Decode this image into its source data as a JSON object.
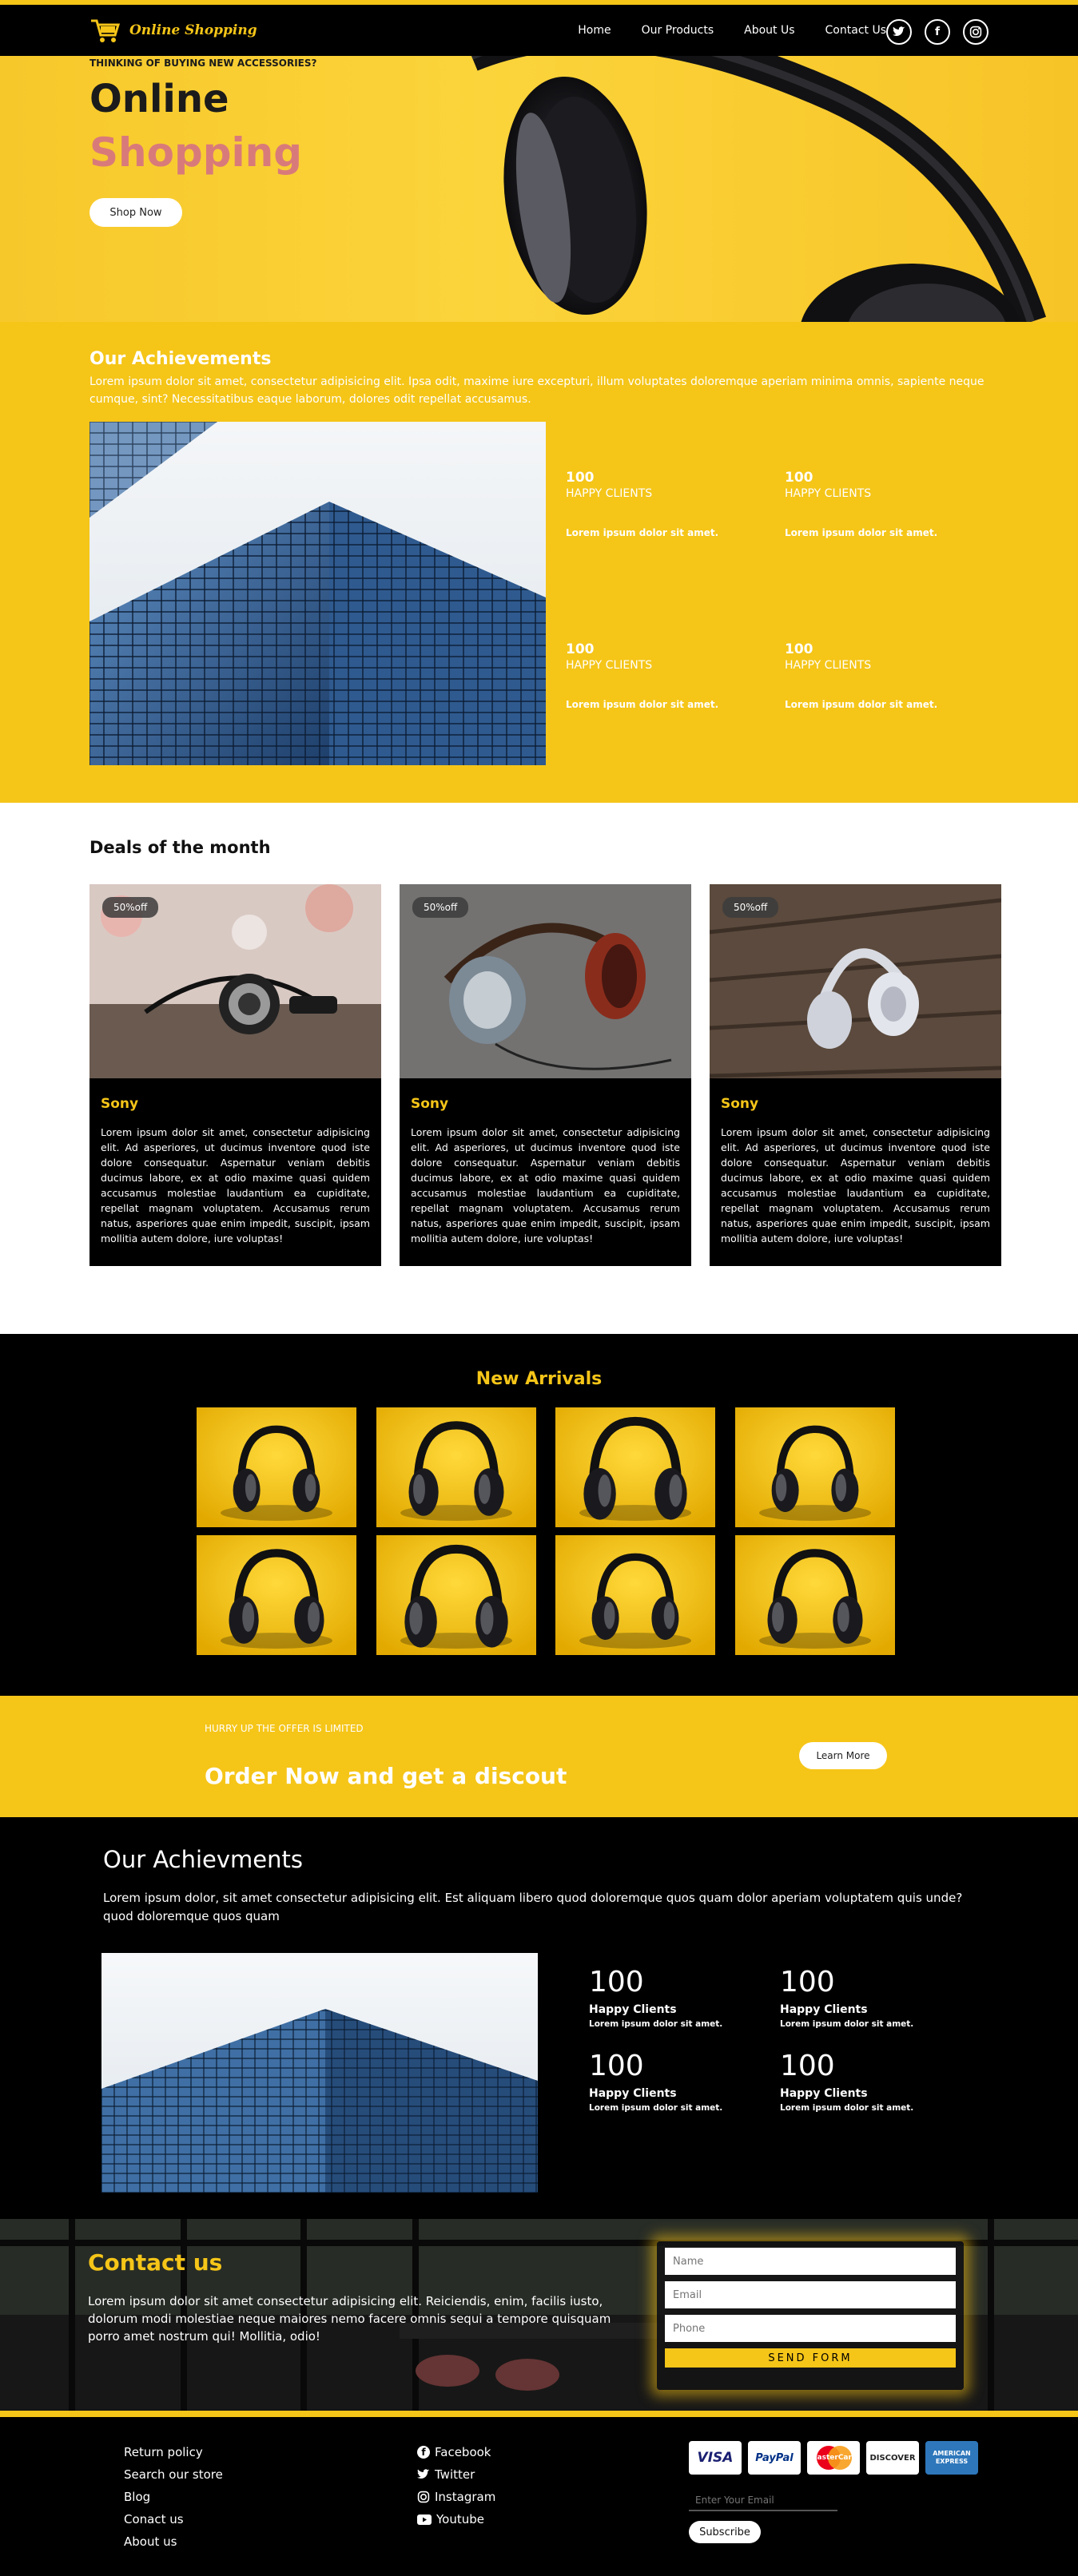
{
  "nav": {
    "brand": "Online Shopping",
    "links": [
      "Home",
      "Our Products",
      "About Us",
      "Contact Us"
    ],
    "social_icons": [
      "twitter-icon",
      "facebook-icon",
      "instagram-icon"
    ]
  },
  "hero": {
    "tagline": "THINKING OF BUYING NEW ACCESSORIES?",
    "title_line1": "Online",
    "title_line2": "Shopping",
    "button": "Shop Now"
  },
  "achievements": {
    "title": "Our Achievements",
    "description": "Lorem ipsum dolor sit amet, consectetur adipisicing elit. Ipsa odit, maxime iure excepturi, illum voluptates doloremque aperiam minima omnis, sapiente neque cumque, sint? Necessitatibus eaque laborum, dolores odit repellat accusamus.",
    "stats": [
      {
        "value": "100",
        "label": "HAPPY CLIENTS",
        "text": "Lorem ipsum dolor sit amet."
      },
      {
        "value": "100",
        "label": "HAPPY CLIENTS",
        "text": "Lorem ipsum dolor sit amet."
      },
      {
        "value": "100",
        "label": "HAPPY CLIENTS",
        "text": "Lorem ipsum dolor sit amet."
      },
      {
        "value": "100",
        "label": "HAPPY CLIENTS",
        "text": "Lorem ipsum dolor sit amet."
      }
    ]
  },
  "deals": {
    "title": "Deals of the month",
    "cards": [
      {
        "badge": "50%off",
        "title": "Sony",
        "text": "Lorem ipsum dolor sit amet, consectetur adipisicing elit. Ad asperiores, ut ducimus inventore quod iste dolore consequatur. Aspernatur veniam debitis ducimus labore, ex at odio maxime quasi quidem accusamus molestiae laudantium ea cupiditate, repellat magnam voluptatem. Accusamus rerum natus, asperiores quae enim impedit, suscipit, ipsam mollitia autem dolore, iure voluptas!"
      },
      {
        "badge": "50%off",
        "title": "Sony",
        "text": "Lorem ipsum dolor sit amet, consectetur adipisicing elit. Ad asperiores, ut ducimus inventore quod iste dolore consequatur. Aspernatur veniam debitis ducimus labore, ex at odio maxime quasi quidem accusamus molestiae laudantium ea cupiditate, repellat magnam voluptatem. Accusamus rerum natus, asperiores quae enim impedit, suscipit, ipsam mollitia autem dolore, iure voluptas!"
      },
      {
        "badge": "50%off",
        "title": "Sony",
        "text": "Lorem ipsum dolor sit amet, consectetur adipisicing elit. Ad asperiores, ut ducimus inventore quod iste dolore consequatur. Aspernatur veniam debitis ducimus labore, ex at odio maxime quasi quidem accusamus molestiae laudantium ea cupiditate, repellat magnam voluptatem. Accusamus rerum natus, asperiores quae enim impedit, suscipit, ipsam mollitia autem dolore, iure voluptas!"
      }
    ]
  },
  "arrivals": {
    "title": "New Arrivals"
  },
  "offer": {
    "subtitle": "HURRY UP THE OFFER IS LIMITED",
    "title": "Order Now and get a discout",
    "button": "Learn More"
  },
  "achievements2": {
    "title": "Our Achievments",
    "description": "Lorem ipsum dolor, sit amet consectetur adipisicing elit. Est aliquam libero quod doloremque quos quam dolor aperiam voluptatem quis unde? quod doloremque quos quam",
    "stats": [
      {
        "value": "100",
        "label": "Happy Clients",
        "text": "Lorem ipsum dolor sit amet."
      },
      {
        "value": "100",
        "label": "Happy Clients",
        "text": "Lorem ipsum dolor sit amet."
      },
      {
        "value": "100",
        "label": "Happy Clients",
        "text": "Lorem ipsum dolor sit amet."
      },
      {
        "value": "100",
        "label": "Happy Clients",
        "text": "Lorem ipsum dolor sit amet."
      }
    ]
  },
  "contact": {
    "title": "Contact us",
    "text": "Lorem ipsum dolor sit amet consectetur adipisicing elit. Reiciendis, enim, facilis iusto, dolorum modi molestiae neque maiores nemo facere omnis sequi a tempore quisquam porro amet nostrum qui! Mollitia, odio!",
    "name_placeholder": "Name",
    "email_placeholder": "Email",
    "phone_placeholder": "Phone",
    "send": "SEND FORM"
  },
  "footer": {
    "links": [
      "Return policy",
      "Search our store",
      "Blog",
      "Conact us",
      "About us"
    ],
    "social": [
      {
        "icon": "facebook-icon",
        "label": "Facebook"
      },
      {
        "icon": "twitter-icon",
        "label": "Twitter"
      },
      {
        "icon": "instagram-icon",
        "label": "Instagram"
      },
      {
        "icon": "youtube-icon",
        "label": "Youtube"
      }
    ],
    "payment_cards": [
      "VISA",
      "PayPal",
      "MasterCard",
      "DISCOVER",
      "AMERICAN EXPRESS"
    ],
    "email_placeholder": "Enter Your Email",
    "subscribe": "Subscribe"
  },
  "colors": {
    "accent": "#f5c518",
    "dark": "#000000",
    "hero_pink": "#d97a7a"
  }
}
